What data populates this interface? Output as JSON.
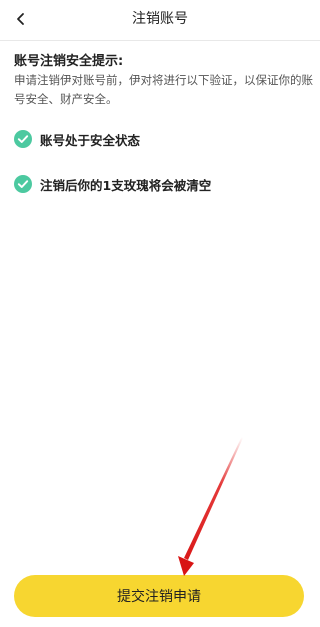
{
  "header": {
    "back_icon": "chevron-left-icon",
    "title": "注销账号"
  },
  "notice": {
    "title": "账号注销安全提示:",
    "description": "申请注销伊对账号前，伊对将进行以下验证，以保证你的账号安全、财产安全。"
  },
  "checks": [
    {
      "icon": "check-circle-icon",
      "label": "账号处于安全状态"
    },
    {
      "icon": "check-circle-icon",
      "label": "注销后你的1支玫瑰将会被清空"
    }
  ],
  "footer": {
    "submit_label": "提交注销申请"
  },
  "colors": {
    "accent": "#f7d630",
    "check": "#4cc9a0",
    "annotation_arrow": "#e01818"
  }
}
